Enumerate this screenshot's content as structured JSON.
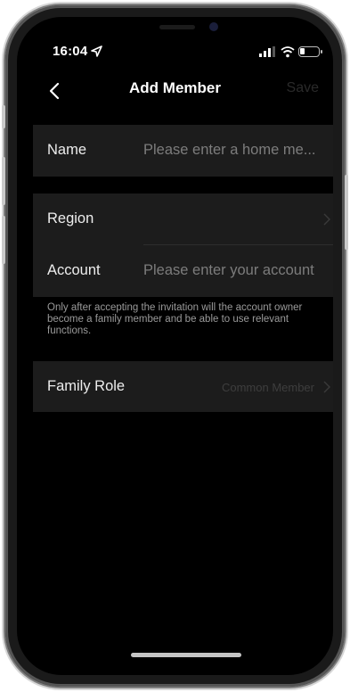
{
  "status_bar": {
    "time": "16:04"
  },
  "nav": {
    "title": "Add Member",
    "save_label": "Save"
  },
  "form": {
    "name": {
      "label": "Name",
      "placeholder": "Please enter a home me..."
    },
    "region": {
      "label": "Region",
      "value": ""
    },
    "account": {
      "label": "Account",
      "placeholder": "Please enter your account"
    },
    "note": "Only after accepting the invitation will the account owner become a family member and be able to use relevant functions.",
    "family_role": {
      "label": "Family Role",
      "value": "Common Member"
    }
  },
  "colors": {
    "background": "#000000",
    "cell": "#1c1c1c",
    "text": "#ededed",
    "placeholder": "#7c7c7c",
    "save_disabled": "#2a2a2a"
  },
  "icons": [
    "location-arrow-icon",
    "signal-icon",
    "wifi-icon",
    "battery-icon",
    "back-chevron-icon",
    "chevron-right-icon"
  ]
}
